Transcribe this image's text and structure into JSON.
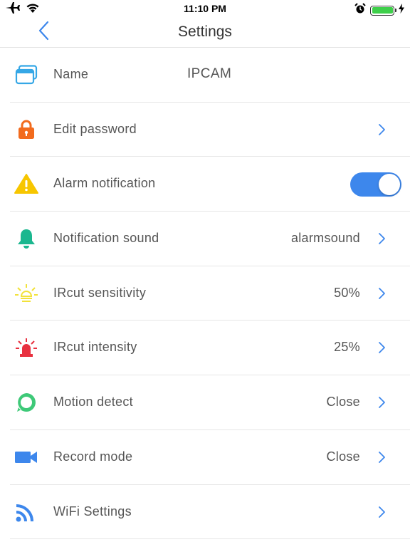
{
  "status_bar": {
    "time": "11:10 PM",
    "icons": [
      "airplane-icon",
      "wifi-icon",
      "alarm-icon",
      "battery-icon",
      "charging-icon"
    ],
    "battery_level": 1.0
  },
  "nav": {
    "title": "Settings",
    "back_icon": "chevron-left-icon"
  },
  "colors": {
    "accent": "#3d87ec",
    "chevron": "#3d87ec",
    "name_icon": "#35a7e6",
    "password_icon": "#f26b1d",
    "alarm_icon": "#f7c600",
    "sound_icon": "#1bb78f",
    "ircut_sensitivity_icon": "#f2e23a",
    "ircut_intensity_icon": "#e8303f",
    "motion_icon": "#3ec978",
    "record_icon": "#3d87ec",
    "wifi_icon": "#3d87ec",
    "battery_fill": "#3ecf4a"
  },
  "settings": {
    "name": {
      "label": "Name",
      "value": "IPCAM",
      "icon": "window-icon"
    },
    "edit_password": {
      "label": "Edit password",
      "icon": "lock-icon"
    },
    "alarm_notification": {
      "label": "Alarm notification",
      "icon": "warning-icon",
      "enabled": true
    },
    "notification_sound": {
      "label": "Notification sound",
      "value": "alarmsound",
      "icon": "bell-icon"
    },
    "ircut_sensitivity": {
      "label": "IRcut sensitivity",
      "value": "50%",
      "icon": "light-bulb-icon"
    },
    "ircut_intensity": {
      "label": "IRcut intensity",
      "value": "25%",
      "icon": "red-light-icon"
    },
    "motion_detect": {
      "label": "Motion detect",
      "value": "Close",
      "icon": "motion-icon"
    },
    "record_mode": {
      "label": "Record mode",
      "value": "Close",
      "icon": "video-camera-icon"
    },
    "wifi_settings": {
      "label": "WiFi Settings",
      "icon": "wifi-signal-icon"
    }
  }
}
